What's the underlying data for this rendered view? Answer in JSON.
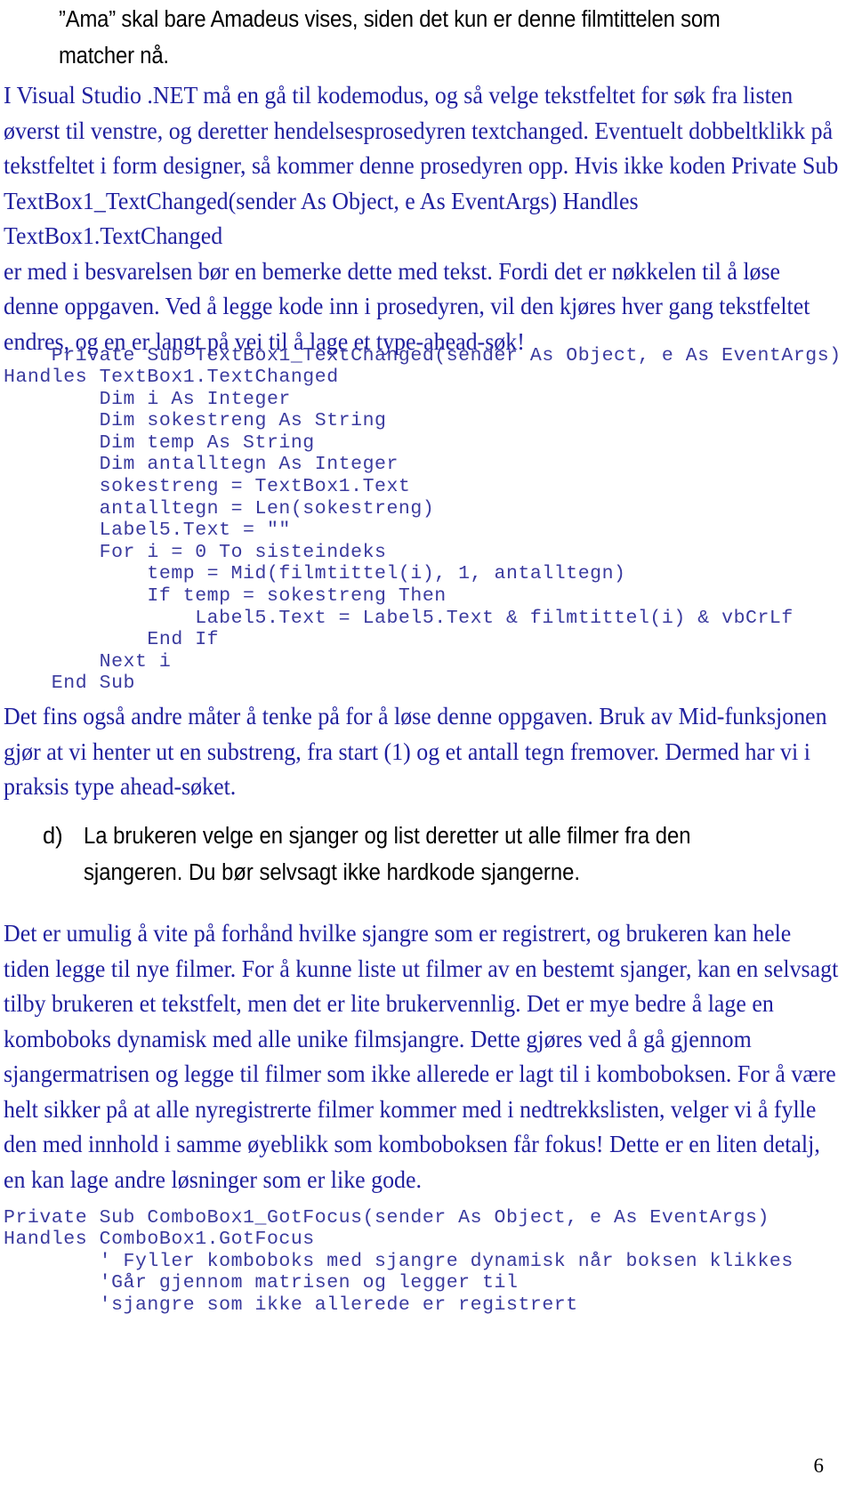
{
  "document": {
    "page_number": "6",
    "colors": {
      "body_blue": "#1f1f9e",
      "code_blue": "#3a3a9e",
      "black": "#000000",
      "background": "#ffffff"
    }
  },
  "intro": {
    "text": "”Ama” skal bare Amadeus vises, siden det kun er denne filmtittelen som matcher nå."
  },
  "paragraphs": {
    "p1": "I Visual Studio .NET må en gå til kodemodus, og så velge tekstfeltet for søk fra listen øverst til venstre, og deretter hendelsesprosedyren textchanged. Eventuelt dobbeltklikk på tekstfeltet i form designer, så kommer denne prosedyren opp. Hvis ikke koden Private Sub TextBox1_TextChanged(sender As Object, e As EventArgs) Handles TextBox1.TextChanged\ner med i besvarelsen bør en bemerke dette med tekst. Fordi det er nøkkelen til å løse denne oppgaven. Ved å legge kode inn i prosedyren, vil den kjøres hver gang tekstfeltet endres, og en er langt på vei til å lage et type-ahead-søk!",
    "p2": "Det fins også andre måter å tenke på for å løse denne oppgaven. Bruk av Mid-funksjonen gjør at vi henter ut en substreng, fra start (1) og et antall tegn fremover. Dermed har vi i praksis type ahead-søket.",
    "p3": "Det er umulig å vite på forhånd hvilke sjangre som er registrert, og brukeren kan hele tiden legge til nye filmer. For å kunne liste ut filmer av en bestemt sjanger, kan en selvsagt tilby brukeren et tekstfelt, men det er lite brukervennlig. Det er mye bedre å lage en komboboks dynamisk med alle unike filmsjangre. Dette gjøres ved å gå gjennom sjangermatrisen og legge til filmer som ikke allerede er lagt til i komboboksen. For å være helt sikker på at alle nyregistrerte filmer kommer med i nedtrekkslisten, velger vi å fylle den med innhold i samme øyeblikk som komboboksen får fokus! Dette er en liten detalj, en kan lage andre løsninger som er like gode."
  },
  "list_item_d": {
    "marker": "d)",
    "text": "La brukeren velge en sjanger og list deretter ut alle filmer fra den sjangeren. Du bør selvsagt ikke hardkode sjangerne."
  },
  "code_blocks": {
    "textchanged": "    Private Sub TextBox1_TextChanged(sender As Object, e As EventArgs)\nHandles TextBox1.TextChanged\n        Dim i As Integer\n        Dim sokestreng As String\n        Dim temp As String\n        Dim antalltegn As Integer\n        sokestreng = TextBox1.Text\n        antalltegn = Len(sokestreng)\n        Label5.Text = \"\"\n        For i = 0 To sisteindeks\n            temp = Mid(filmtittel(i), 1, antalltegn)\n            If temp = sokestreng Then\n                Label5.Text = Label5.Text & filmtittel(i) & vbCrLf\n            End If\n        Next i\n    End Sub",
    "gotfocus": "Private Sub ComboBox1_GotFocus(sender As Object, e As EventArgs)\nHandles ComboBox1.GotFocus\n        ' Fyller komboboks med sjangre dynamisk når boksen klikkes\n        'Går gjennom matrisen og legger til\n        'sjangre som ikke allerede er registrert"
  }
}
